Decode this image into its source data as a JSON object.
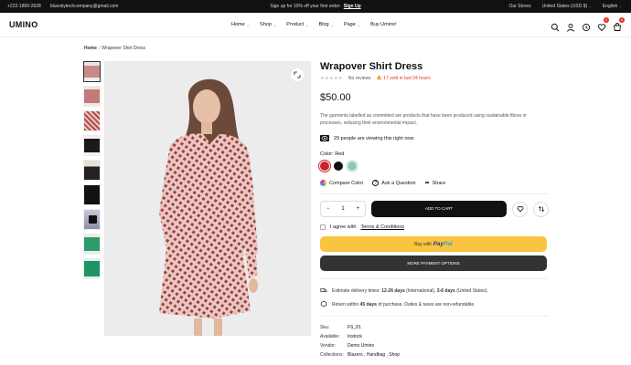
{
  "topbar": {
    "phone": "+222-1800-2628",
    "email": "blueskytechcompany@gmail.com",
    "promo": "Sign up for 10% off your first order:",
    "promo_link": "Sign Up",
    "stores": "Our Stores",
    "currency": "United States (USD $)",
    "language": "English"
  },
  "header": {
    "logo": "UMINO",
    "nav": [
      "Home",
      "Shop",
      "Product",
      "Blog",
      "Page",
      "Buy Umino!"
    ],
    "wishlist_count": "1",
    "cart_count": "0"
  },
  "breadcrumb": {
    "home": "Home",
    "current": "Wrapover Shirt Dress"
  },
  "product": {
    "title": "Wrapover Shirt Dress",
    "reviews": "No reviews",
    "sold": "17 sold in last 24 hours",
    "price": "$50.00",
    "description": "The garments labelled as committed are products that have been produced using sustainable fibres or processes, reducing their environmental impact.",
    "viewing": "29 people are viewing this right now",
    "color_label": "Color:",
    "color_value": "Red",
    "swatches": [
      "#c8222a",
      "#111111",
      "#8ac9b6"
    ],
    "compare": "Compare Color",
    "ask": "Ask a Question",
    "share": "Share",
    "quantity": "1",
    "add_to_cart": "ADD TO CART",
    "agree_text": "I agree with",
    "agree_link": "Terms & Conditions",
    "pay_with": "Buy with",
    "paypal_a": "Pay",
    "paypal_b": "Pal",
    "more_payment": "MORE PAYMENT OPTIONS",
    "delivery_pre": "Estimate delivery times:",
    "delivery_intl": "12-26 days",
    "delivery_intl_note": "(International),",
    "delivery_us": "3-6 days",
    "delivery_us_note": "(United States).",
    "return_pre": "Return within",
    "return_days": "45 days",
    "return_post": "of purchase. Duties & taxes are non-refundable.",
    "meta": [
      {
        "key": "Sku:",
        "value": "FS_81"
      },
      {
        "key": "Available:",
        "value": "Instock"
      },
      {
        "key": "Vendor:",
        "value": "Demo Umino"
      },
      {
        "key": "Collections:",
        "value": "Blazers , Handbag , Shop"
      }
    ]
  },
  "colors": {
    "accent": "#e3331f",
    "paypal": "#f9c440",
    "dark": "#111111"
  }
}
